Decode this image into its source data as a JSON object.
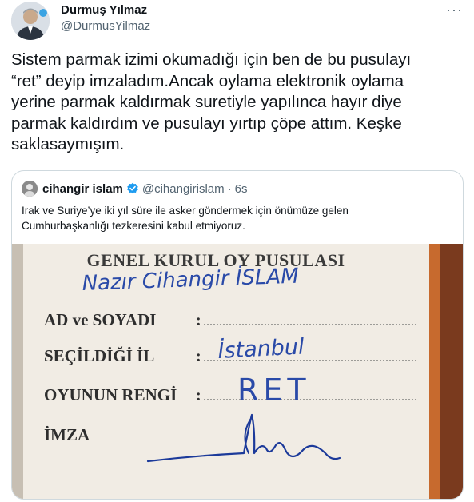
{
  "tweet": {
    "author_name": "Durmuş Yılmaz",
    "author_handle": "@DurmusYilmaz",
    "more_label": "···",
    "text": "Sistem parmak izimi okumadığı için ben de bu pusulayı\n“ret” deyip imzaladım.Ancak oylama elektronik oylama\nyerine parmak kaldırmak suretiyle yapılınca hayır diye\nparmak kaldırdım ve pusulayı yırtıp çöpe attım. Keşke\nsaklasaymışım."
  },
  "quote": {
    "author_name": "cihangir islam",
    "author_handle": "@cihangirislam",
    "separator": "·",
    "time": "6s",
    "text": "Irak ve Suriye’ye iki yıl süre ile asker göndermek için önümüze gelen\nCumhurbaşkanlığı tezkeresini kabul etmiyoruz."
  },
  "ballot": {
    "title": "GENEL KURUL OY PUSULASI",
    "handwritten_name": "Nazır Cihangir İSLAM",
    "field_name": "AD ve SOYADI",
    "field_city": "SEÇİLDİĞİ İL",
    "field_vote": "OYUNUN RENGİ",
    "field_signature": "İMZA",
    "handwritten_city": "İstanbul",
    "handwritten_vote": "RET"
  },
  "colors": {
    "verified": "#1d9bf0",
    "secondary_text": "#536471",
    "border": "#cfd9de",
    "ink": "#1c3a9a"
  }
}
